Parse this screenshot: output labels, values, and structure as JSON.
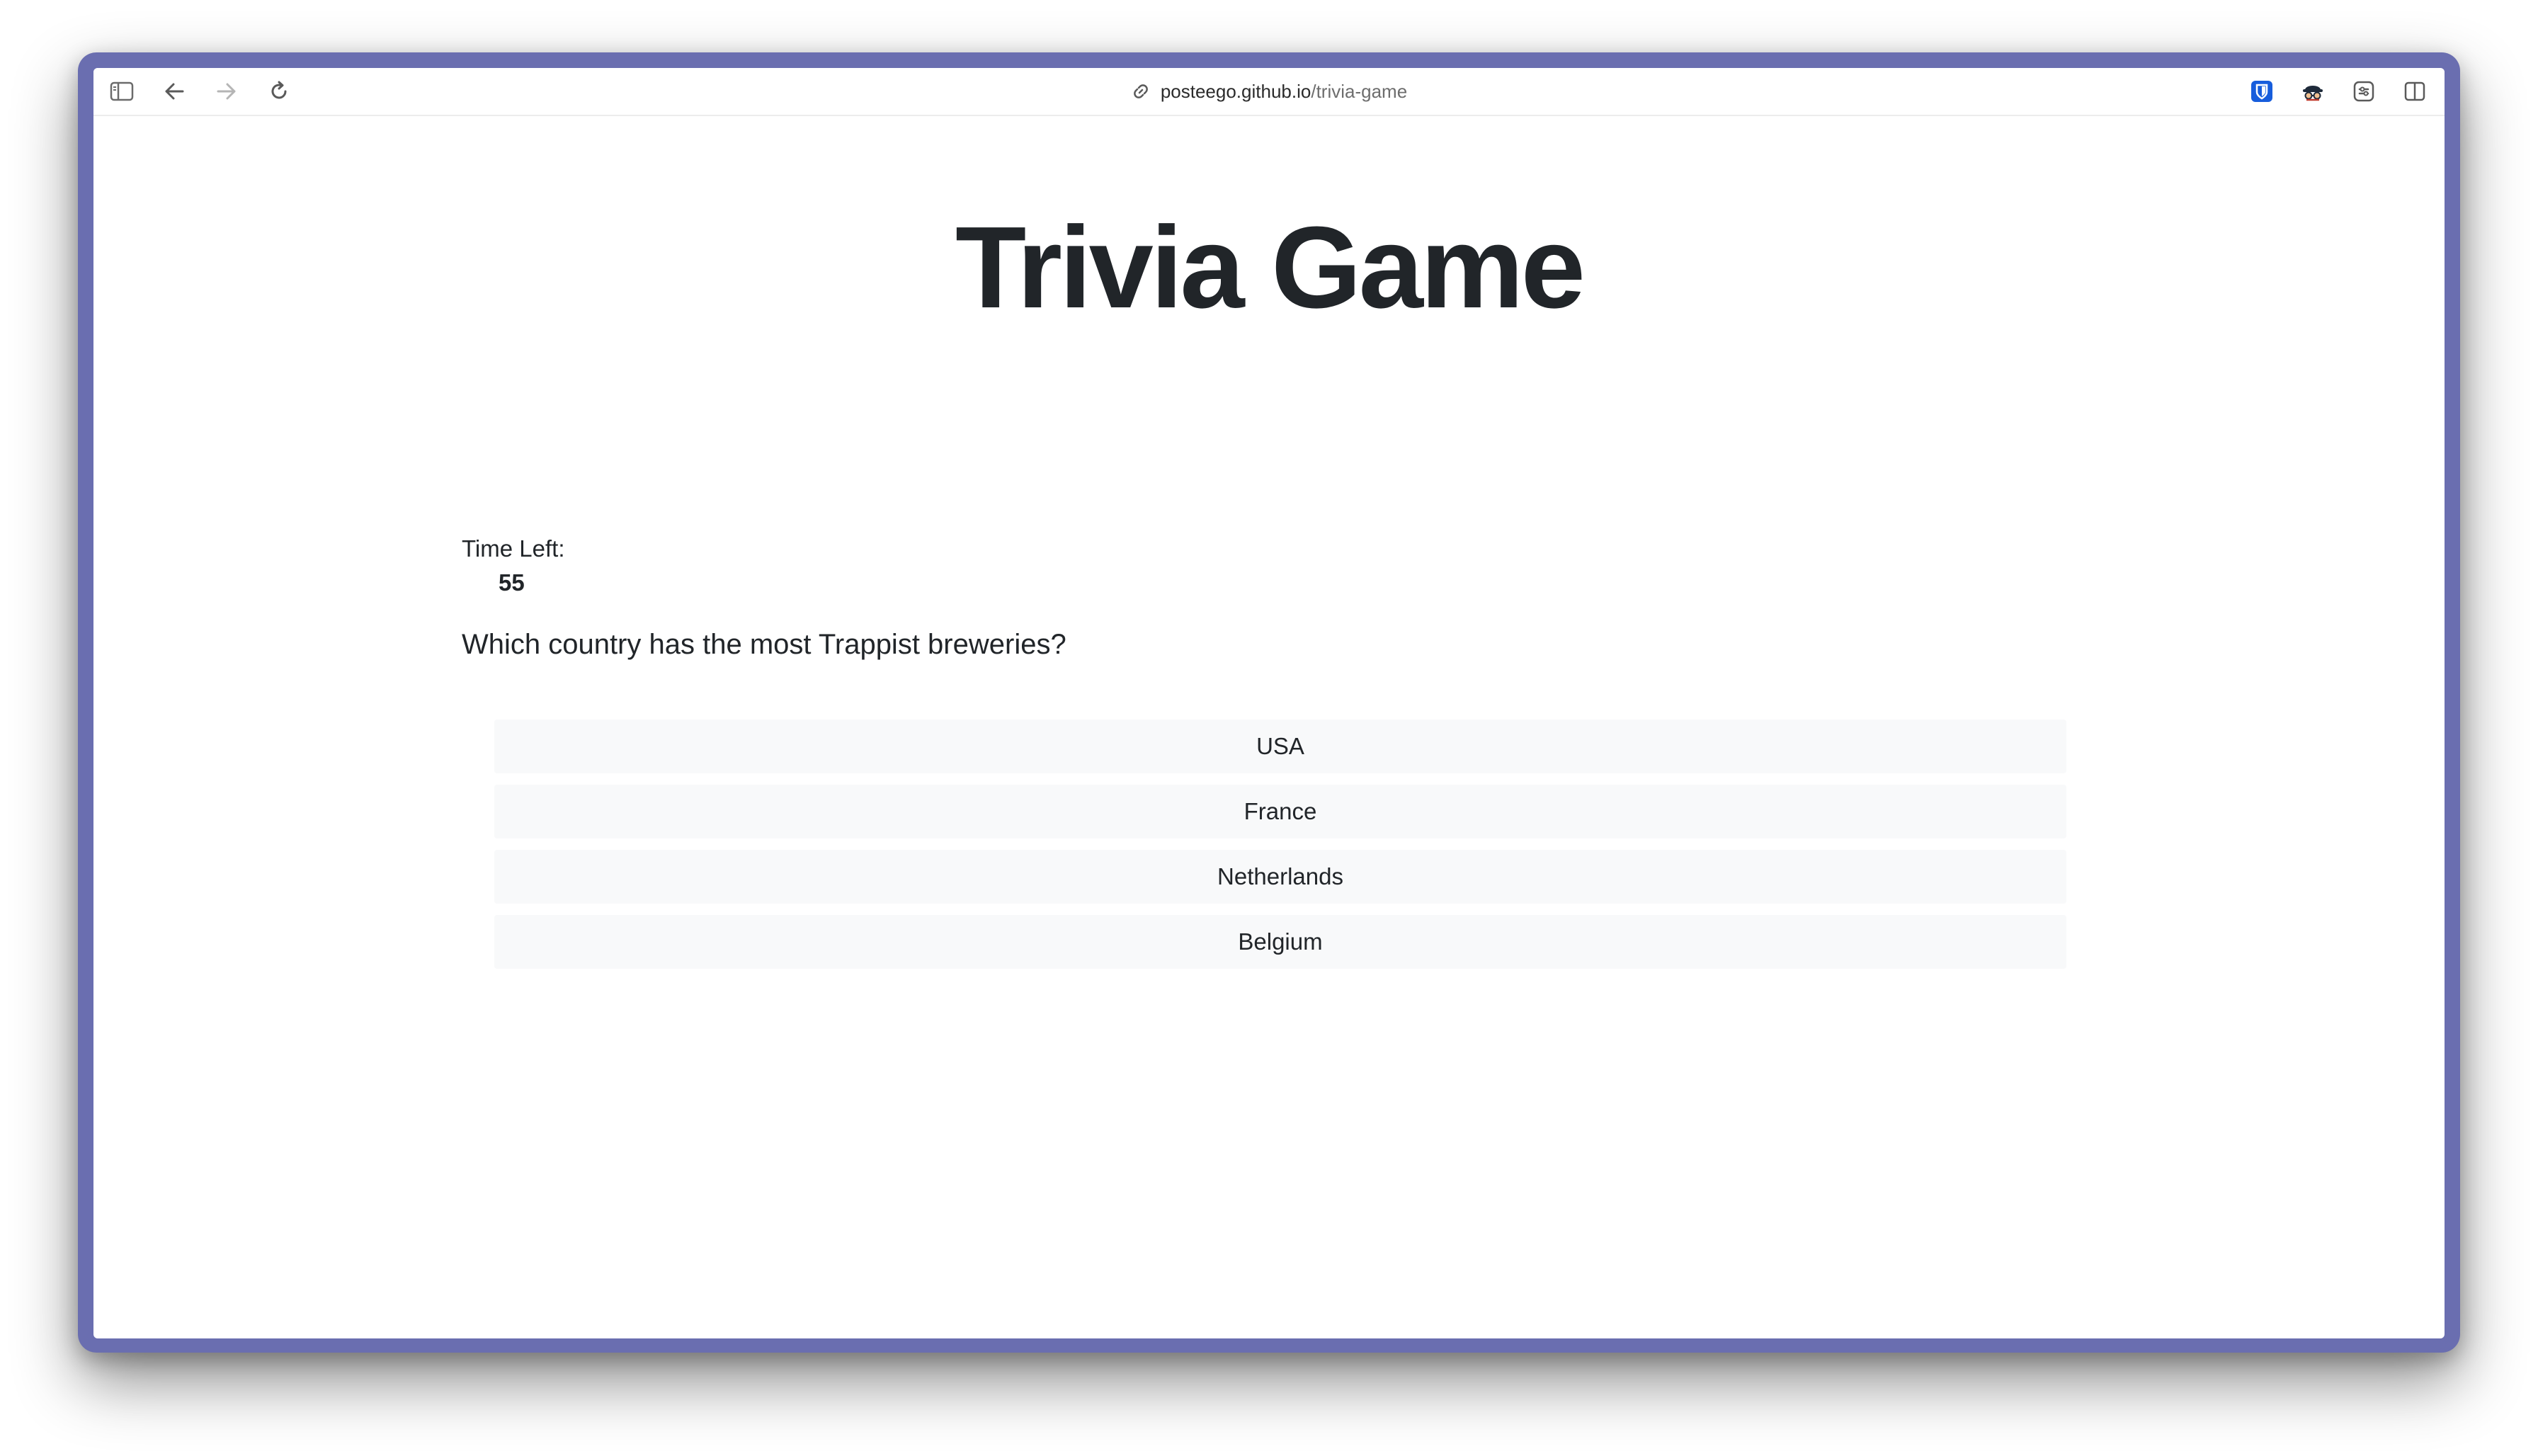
{
  "browser": {
    "url_host": "posteego.github.io",
    "url_path": "/trivia-game",
    "icons": {
      "sidebar": "sidebar-toggle-icon",
      "back": "back-arrow-icon",
      "forward": "forward-arrow-icon",
      "reload": "reload-icon",
      "link": "link-icon",
      "bitwarden": "bitwarden-extension-icon",
      "extension2": "incognito-extension-icon",
      "extension3": "extension-icon",
      "split": "split-view-icon"
    },
    "frame_color": "#6a6eb0"
  },
  "page": {
    "title": "Trivia Game",
    "timer_label": "Time Left:",
    "timer_value": "55",
    "question": "Which country has the most Trappist breweries?",
    "answers": [
      "USA",
      "France",
      "Netherlands",
      "Belgium"
    ],
    "button_bg": "#f8f9fa",
    "text_color": "#212529"
  }
}
